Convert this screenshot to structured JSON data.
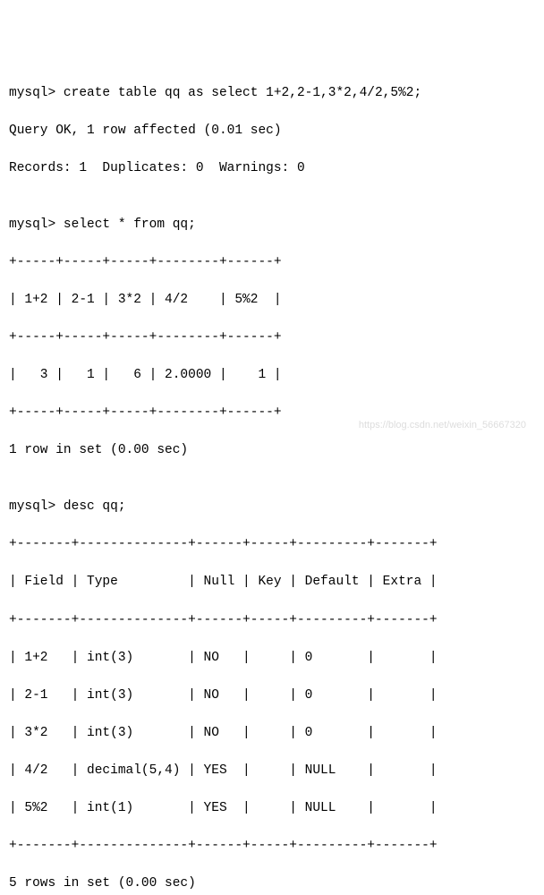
{
  "lines": {
    "l01": "mysql> create table qq as select 1+2,2-1,3*2,4/2,5%2;",
    "l02": "Query OK, 1 row affected (0.01 sec)",
    "l03": "Records: 1  Duplicates: 0  Warnings: 0",
    "l04": "",
    "l05": "mysql> select * from qq;",
    "l06": "+-----+-----+-----+--------+------+",
    "l07": "| 1+2 | 2-1 | 3*2 | 4/2    | 5%2  |",
    "l08": "+-----+-----+-----+--------+------+",
    "l09": "|   3 |   1 |   6 | 2.0000 |    1 |",
    "l10": "+-----+-----+-----+--------+------+",
    "l11": "1 row in set (0.00 sec)",
    "l12": "",
    "l13": "mysql> desc qq;",
    "l14": "+-------+--------------+------+-----+---------+-------+",
    "l15": "| Field | Type         | Null | Key | Default | Extra |",
    "l16": "+-------+--------------+------+-----+---------+-------+",
    "l17": "| 1+2   | int(3)       | NO   |     | 0       |       |",
    "l18": "| 2-1   | int(3)       | NO   |     | 0       |       |",
    "l19": "| 3*2   | int(3)       | NO   |     | 0       |       |",
    "l20": "| 4/2   | decimal(5,4) | YES  |     | NULL    |       |",
    "l21": "| 5%2   | int(1)       | YES  |     | NULL    |       |",
    "l22": "+-------+--------------+------+-----+---------+-------+",
    "l23": "5 rows in set (0.00 sec)"
  },
  "watermark": "https://blog.csdn.net/weixin_56667320"
}
